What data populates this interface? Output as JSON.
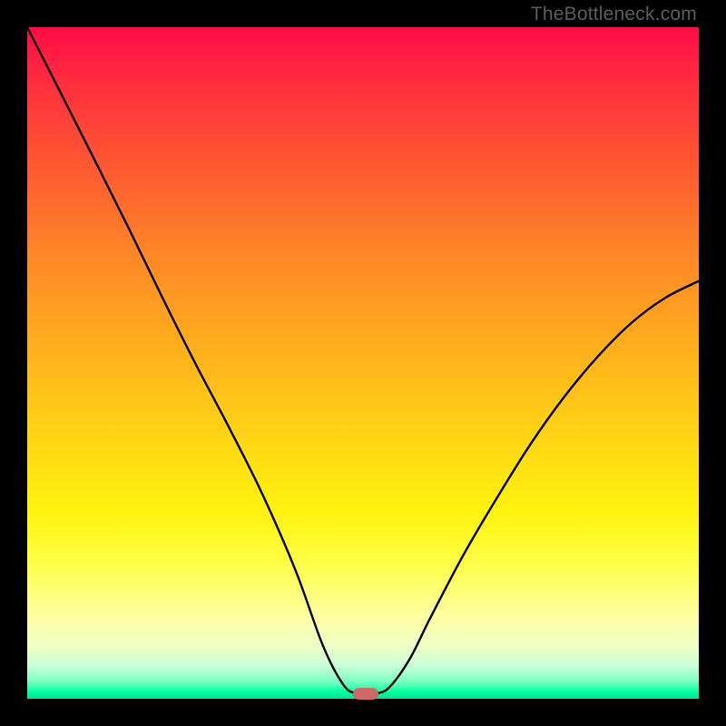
{
  "watermark": "TheBottleneck.com",
  "marker": {
    "cx_frac": 0.504,
    "cy_frac": 0.992
  },
  "chart_data": {
    "type": "line",
    "title": "",
    "xlabel": "",
    "ylabel": "",
    "xlim": [
      0,
      1
    ],
    "ylim": [
      0,
      1
    ],
    "series": [
      {
        "name": "bottleneck-curve",
        "x": [
          0.0,
          0.05,
          0.1,
          0.15,
          0.2,
          0.25,
          0.3,
          0.35,
          0.4,
          0.44,
          0.47,
          0.49,
          0.52,
          0.54,
          0.57,
          0.6,
          0.65,
          0.7,
          0.75,
          0.8,
          0.85,
          0.9,
          0.95,
          1.0
        ],
        "y": [
          1.0,
          0.902,
          0.803,
          0.703,
          0.6,
          0.5,
          0.405,
          0.305,
          0.19,
          0.08,
          0.022,
          0.008,
          0.008,
          0.018,
          0.06,
          0.12,
          0.215,
          0.3,
          0.38,
          0.45,
          0.51,
          0.56,
          0.597,
          0.622
        ]
      }
    ],
    "annotations": [
      {
        "type": "marker",
        "shape": "rounded-rect",
        "x": 0.504,
        "y": 0.008,
        "color": "#cb6a66"
      }
    ],
    "background_gradient": [
      "#ff0b47",
      "#ffaa1e",
      "#fff20e",
      "#00ffa3"
    ]
  }
}
